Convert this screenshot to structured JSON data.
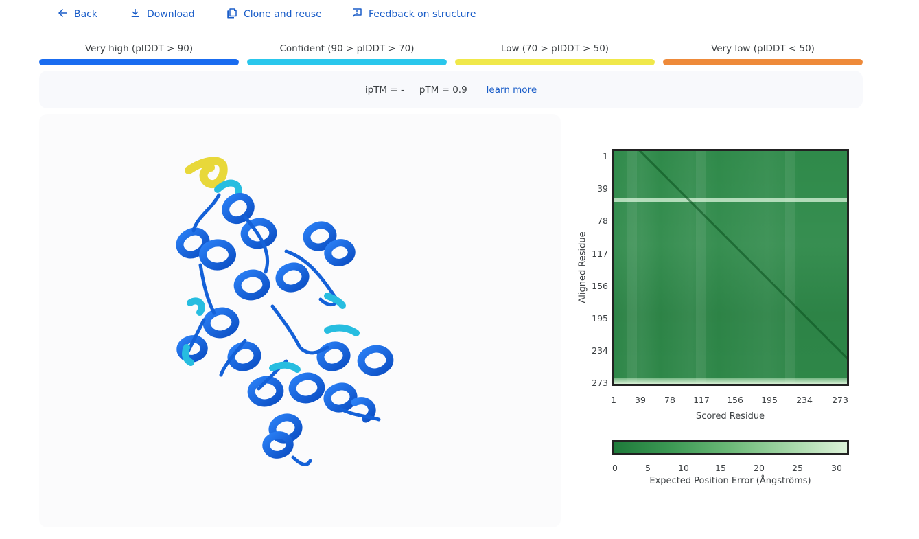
{
  "toolbar": {
    "back": "Back",
    "download": "Download",
    "clone": "Clone and reuse",
    "feedback": "Feedback on structure"
  },
  "legend": [
    {
      "label": "Very high (pIDDT > 90)",
      "color": "#1a6cf0"
    },
    {
      "label": "Confident (90 > pIDDT > 70)",
      "color": "#2ac7ec"
    },
    {
      "label": "Low (70 > pIDDT > 50)",
      "color": "#f0e84a"
    },
    {
      "label": "Very low (pIDDT < 50)",
      "color": "#ee8a3a"
    }
  ],
  "metrics": {
    "iptm": "ipTM = -",
    "ptm": "pTM = 0.9",
    "learn_more": "learn more"
  },
  "pae": {
    "y_ticks": [
      "1",
      "39",
      "78",
      "117",
      "156",
      "195",
      "234",
      "273"
    ],
    "x_ticks": [
      "1",
      "39",
      "78",
      "117",
      "156",
      "195",
      "234",
      "273"
    ],
    "y_label": "Aligned Residue",
    "x_label": "Scored Residue",
    "colorbar_ticks": [
      "0",
      "5",
      "10",
      "15",
      "20",
      "25",
      "30"
    ],
    "colorbar_label": "Expected Position Error (Ångströms)"
  },
  "colors": {
    "link": "#1a5dc8",
    "very_high": "#1a6cf0",
    "confident": "#2ac7ec",
    "low": "#f0e84a",
    "very_low": "#ee8a3a",
    "pae_low": "#1e7a3a",
    "pae_high": "#dcf2d8"
  }
}
